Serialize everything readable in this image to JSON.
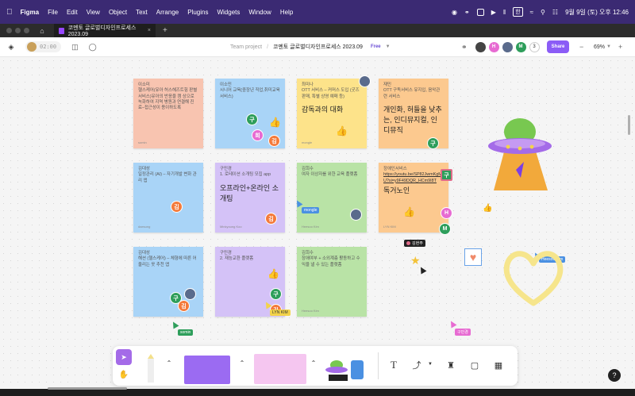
{
  "menubar": {
    "app": "Figma",
    "items": [
      "File",
      "Edit",
      "View",
      "Object",
      "Text",
      "Arrange",
      "Plugins",
      "Widgets",
      "Window",
      "Help"
    ],
    "lang_indicator": "한",
    "datetime": "9월 9일 (토) 오후 12:46"
  },
  "tabbar": {
    "tab_title": "코멘토 글로벌디자인프로세스 2023.09",
    "close": "×",
    "plus": "+"
  },
  "toolbar": {
    "timer": "02:00",
    "breadcrumb_project": "Team project",
    "breadcrumb_sep": "/",
    "file_name": "코멘토 글로벌디자인프로세스 2023.09",
    "plan": "Free",
    "avatars": [
      {
        "letter": "",
        "color": "#444444"
      },
      {
        "letter": "H",
        "color": "#e76bd2"
      },
      {
        "letter": "",
        "color": "#5a6b8c"
      },
      {
        "letter": "M",
        "color": "#2e9e5b"
      }
    ],
    "user_count": "3",
    "share": "Share",
    "zoom": "69%"
  },
  "notes": [
    {
      "author": "이소미",
      "body": "헬스케어(유아 허스헤즈트힘 판별 서비스)유아의 반응을 캠 상으로 녹화하여 지역 병원과 연결해 진료–접근성이 용이하도록",
      "big": "",
      "foot": "somin",
      "color": "#f8c4b0"
    },
    {
      "author": "이소민",
      "body": "시니어 교육(중장년 직업,취미교육 서비스)",
      "big": "",
      "foot": "",
      "color": "#a9d4f7"
    },
    {
      "author": "최미나",
      "body": "OTT 서비스 – 커머스 도입 (굿즈 판매, 특별 상영 예매 등)",
      "big": "감독과의 대화",
      "foot": "mongle",
      "color": "#fde38a"
    },
    {
      "author": "재민",
      "body": "OTT 구독서비스 유지입, 음악관련 서비스",
      "big": "개인화, 허들을 낮추는, 인디뮤지컬, 인디뮤직",
      "foot": "",
      "color": "#fcc98f"
    },
    {
      "author": "김대성",
      "body": "일정관리 (AI) – 자기개발 변화 관리 앱",
      "big": "",
      "foot": "daesung",
      "color": "#a9d4f7"
    },
    {
      "author": "구민경",
      "body": "1. 로테이션 소개팅 모집 app",
      "big": "오프라인+온라인 소개팅",
      "foot": "Minkyoung Koo",
      "color": "#d4c2f7"
    },
    {
      "author": "김희수",
      "body": "여자 이상자를 위한 교육 플랫폼",
      "big": "",
      "foot": "Heesoo Kim",
      "color": "#b9e3a6"
    },
    {
      "author": "장애인서비스",
      "body": "https://youtu.be/SP82JwmKgMU?si=y9F49DQR_HCm9I8T",
      "big": "독거노인",
      "foot": "LYN KIM",
      "color": "#fcc98f"
    },
    {
      "author": "김대성",
      "body": "해션 (헬스케어) – 체형에 따른 어울리는 옷 추천 앱",
      "big": "",
      "foot": "",
      "color": "#a9d4f7"
    },
    {
      "author": "구민경",
      "body": "2. 재능교환 플랫폼",
      "big": "",
      "foot": "",
      "color": "#d4c2f7"
    },
    {
      "author": "김희수",
      "body": "장애여부 + 소외계층 활동하고 수익을 낼 수 있는 플랫폼",
      "big": "",
      "foot": "Heesoo Kim",
      "color": "#b9e3a6"
    }
  ],
  "stickers": [
    {
      "letter": "구",
      "color": "#2e9e5b"
    },
    {
      "letter": "희",
      "color": "#e76bd2"
    },
    {
      "letter": "김",
      "color": "#f47a3a"
    },
    {
      "letter": "구",
      "color": "#2e9e5b"
    },
    {
      "letter": "김",
      "color": "#f47a3a"
    },
    {
      "letter": "김",
      "color": "#f47a3a"
    },
    {
      "letter": "구",
      "color": "#2e9e5b"
    },
    {
      "letter": "H",
      "color": "#e76bd2"
    },
    {
      "letter": "M",
      "color": "#2e9e5b"
    },
    {
      "letter": "구",
      "color": "#2e9e5b"
    },
    {
      "letter": "김",
      "color": "#f47a3a"
    },
    {
      "letter": "구",
      "color": "#2e9e5b"
    },
    {
      "letter": "김",
      "color": "#f47a3a"
    }
  ],
  "cursor_labels": {
    "mongle": "mongle",
    "kim_hyunju": "김현주",
    "heesoo": "Heesoo Kim",
    "lyn": "LYN KIM",
    "somin": "somin",
    "minkyoung": "구민경"
  },
  "help": "?"
}
